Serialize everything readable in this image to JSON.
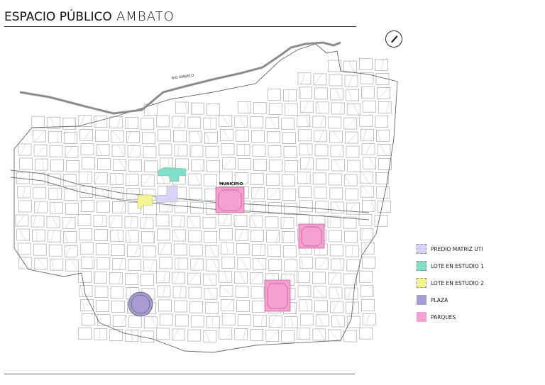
{
  "title": {
    "part1": "ESPACIO PÚBLICO",
    "part2": "AMBATO"
  },
  "map": {
    "river_label": "RIO AMBATO",
    "municipio_label": "MUNICIPIO",
    "colors": {
      "predio": "#d9d4f7",
      "lote1": "#7fe0c8",
      "lote2": "#f4f590",
      "plaza": "#a89ad3",
      "parques": "#f4a0d0",
      "street": "#888888",
      "river": "#8c8c8c"
    }
  },
  "legend": [
    {
      "label": "PREDIO MATRIZ UTI",
      "color": "#d9d4f7",
      "dashed": true
    },
    {
      "label": "LOTE EN ESTUDIO 1",
      "color": "#7fe0c8",
      "dashed": true
    },
    {
      "label": "LOTE EN ESTUDIO 2",
      "color": "#f4f590",
      "dashed": true
    },
    {
      "label": "PLAZA",
      "color": "#a89ad3",
      "dashed": false
    },
    {
      "label": "PARQUES",
      "color": "#f4a0d0",
      "dashed": false
    }
  ],
  "compass": {
    "icon": "north-arrow-icon"
  }
}
